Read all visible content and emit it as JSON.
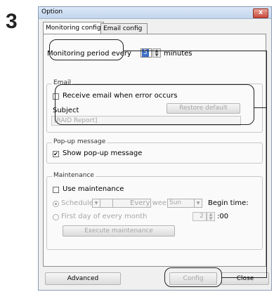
{
  "step_number": "3",
  "window": {
    "title": "Option",
    "close_glyph": "x"
  },
  "tabs": [
    {
      "label": "Monitoring config"
    },
    {
      "label": "Email config"
    }
  ],
  "monitoring": {
    "label_prefix": "Monitoring period every",
    "value": "5",
    "label_suffix": "minutes"
  },
  "email": {
    "legend": "Email",
    "receive_label": "Receive email when error occurs",
    "receive_checked": false,
    "subject_label": "Subject",
    "restore_default_label": "Restore default",
    "subject_value": "[RAID Report]"
  },
  "popup": {
    "legend": "Pop-up message",
    "show_label": "Show pop-up message",
    "show_checked": true,
    "check_glyph": "✔"
  },
  "maintenance": {
    "legend": "Maintenance",
    "use_label": "Use maintenance",
    "schedule_label": "Schedule",
    "every_week_label": "Every week",
    "day_value": "Sun",
    "begin_time_label": "Begin time:",
    "first_day_label": "First day of every month",
    "hour_value": "2",
    "minute_suffix": ":00",
    "execute_label": "Execute maintenance"
  },
  "buttons": {
    "advanced": "Advanced",
    "config": "Config",
    "close": "Close"
  }
}
